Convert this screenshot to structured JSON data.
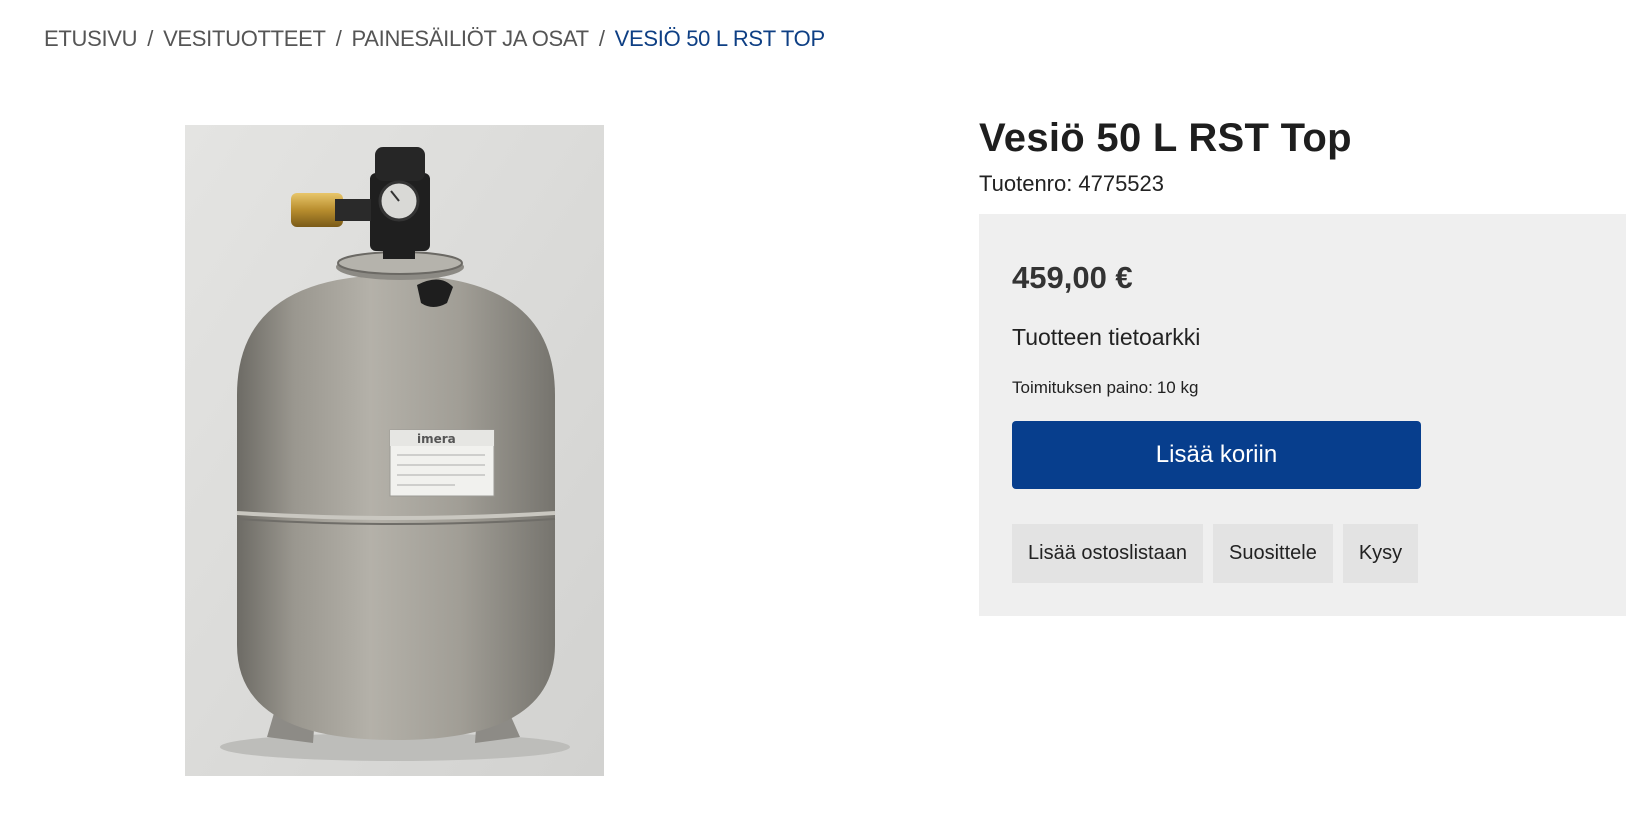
{
  "breadcrumb": {
    "items": [
      "ETUSIVU",
      "VESITUOTTEET",
      "PAINESÄILIÖT JA OSAT"
    ],
    "current": "VESIÖ 50 L RST TOP",
    "separator": "/"
  },
  "product": {
    "title": "Vesiö 50 L RST Top",
    "sku_label": "Tuotenro:",
    "sku": "4775523",
    "price": "459,00 €",
    "datasheet_link": "Tuotteen tietoarkki",
    "shipping_weight_label": "Toimituksen paino:",
    "shipping_weight": "10 kg",
    "image_label_brand": "imera"
  },
  "actions": {
    "add_to_cart": "Lisää koriin",
    "add_to_list": "Lisää ostoslistaan",
    "recommend": "Suosittele",
    "ask": "Kysy"
  },
  "colors": {
    "accent": "#073e8d",
    "breadcrumb_current": "#0e3f84",
    "panel_bg": "#efefef",
    "secondary_button_bg": "#e3e3e3"
  }
}
